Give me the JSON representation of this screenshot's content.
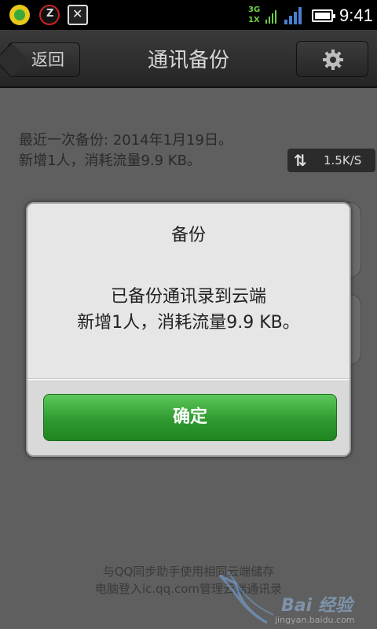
{
  "status_bar": {
    "network_top": "3G",
    "network_bottom": "1X",
    "time": "9:41",
    "icons": [
      "app-icon-1",
      "app-icon-2",
      "app-icon-3",
      "signal-icon",
      "battery-icon"
    ]
  },
  "header": {
    "back_label": "返回",
    "title": "通讯备份",
    "settings_icon": "gear-icon"
  },
  "main": {
    "last_backup": "最近一次备份: 2014年1月19日。",
    "last_backup_detail": "新增1人，消耗流量9.9 KB。",
    "speed": "1.5K/S",
    "footer_line1": "与QQ同步助手使用相同云端储存",
    "footer_line2": "电脑登入ic.qq.com管理云端通讯录"
  },
  "dialog": {
    "title": "备份",
    "message_line1": "已备份通讯录到云端",
    "message_line2": "新增1人，消耗流量9.9 KB。",
    "confirm_label": "确定"
  },
  "watermark": {
    "text": "Bai 经验",
    "url": "jingyan.baidu.com"
  },
  "colors": {
    "confirm_green": "#2f9a2f",
    "titlebar_dark": "#2e2e2e",
    "overlay_gray": "#5f5f5f"
  }
}
